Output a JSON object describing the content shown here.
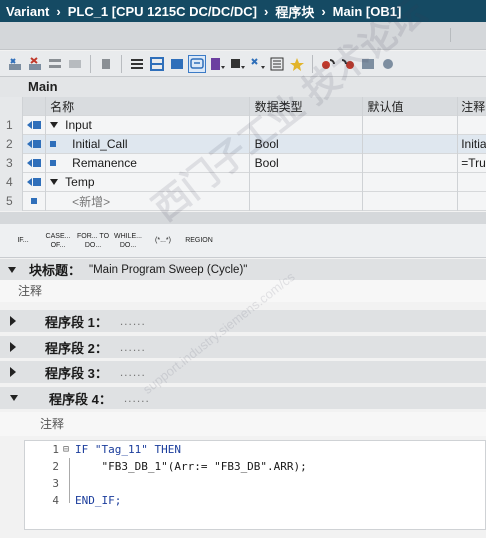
{
  "title_bar": {
    "crumbs": [
      "Variant",
      "PLC_1 [CPU 1215C DC/DC/DC]",
      "程序块",
      "Main [OB1]"
    ],
    "separator": "›"
  },
  "block_interface": {
    "block_name": "Main",
    "columns": [
      "名称",
      "数据类型",
      "默认值",
      "注释"
    ],
    "rows": [
      {
        "num": "1",
        "name": "Input",
        "type": "",
        "default": "",
        "comment": "",
        "level": 0,
        "expanded": true
      },
      {
        "num": "2",
        "name": "Initial_Call",
        "type": "Bool",
        "default": "",
        "comment": "Initia",
        "level": 1
      },
      {
        "num": "3",
        "name": "Remanence",
        "type": "Bool",
        "default": "",
        "comment": "=True",
        "level": 1
      },
      {
        "num": "4",
        "name": "Temp",
        "type": "",
        "default": "",
        "comment": "",
        "level": 0,
        "expanded": true
      },
      {
        "num": "5",
        "name": "<新增>",
        "type": "",
        "default": "",
        "comment": "",
        "level": 1
      }
    ]
  },
  "instructions": [
    {
      "label": "IF..."
    },
    {
      "label": "CASE... OF..."
    },
    {
      "label": "FOR... TO DO..."
    },
    {
      "label": "WHILE... DO..."
    },
    {
      "label": "(*...*)"
    },
    {
      "label": "REGION"
    }
  ],
  "block_title": {
    "label": "块标题：",
    "value": "\"Main Program Sweep (Cycle)\"",
    "comment": "注释"
  },
  "networks": [
    {
      "label": "程序段 1：",
      "dots": "......",
      "expanded": false
    },
    {
      "label": "程序段 2：",
      "dots": "......",
      "expanded": false
    },
    {
      "label": "程序段 3：",
      "dots": "......",
      "expanded": false
    },
    {
      "label": "程序段 4：",
      "dots": "......",
      "expanded": true,
      "comment": "注释"
    }
  ],
  "code_lines": [
    {
      "num": "1",
      "fold": "⊟",
      "text": "IF \"Tag_11\" THEN"
    },
    {
      "num": "2",
      "fold": "",
      "text": "    \"FB3_DB_1\"(Arr:= \"FB3_DB\".ARR);"
    },
    {
      "num": "3",
      "fold": "",
      "text": ""
    },
    {
      "num": "4",
      "fold": "",
      "text": "END_IF;"
    }
  ],
  "watermark": {
    "main": "西门子工业 技术论坛",
    "sub": "support.industry.siemens.com/cs"
  },
  "colors": {
    "title_bar": "#154a63",
    "accent_blue": "#2f6fba",
    "keyword": "#1b3d9c"
  }
}
